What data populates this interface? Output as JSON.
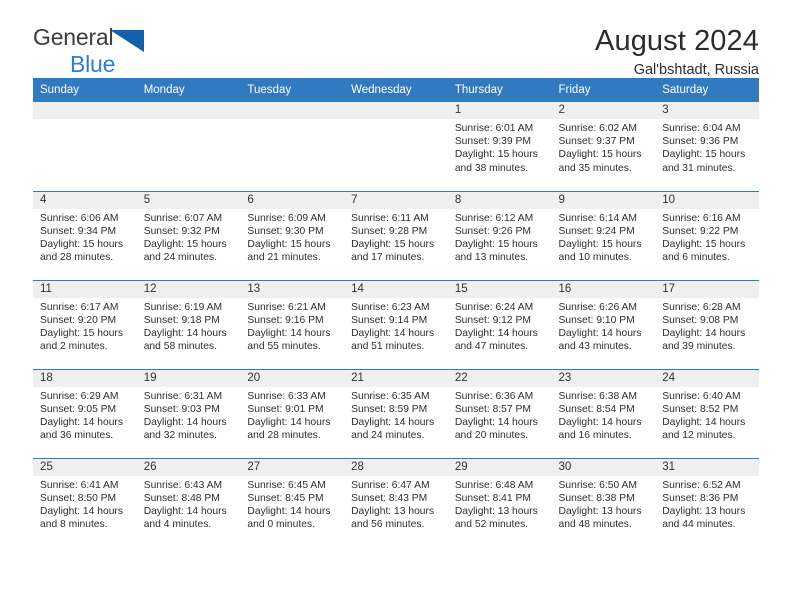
{
  "brand": {
    "name_part1": "General",
    "name_part2": "Blue",
    "logo_icon": "triangle-logo-icon",
    "accent_color": "#2a7fd4"
  },
  "header": {
    "title": "August 2024",
    "location": "Gal'bshtadt, Russia",
    "header_bg": "#3179c0",
    "daynum_bg": "#efefef"
  },
  "weekdays": [
    "Sunday",
    "Monday",
    "Tuesday",
    "Wednesday",
    "Thursday",
    "Friday",
    "Saturday"
  ],
  "labels": {
    "sunrise_prefix": "Sunrise:",
    "sunset_prefix": "Sunset:",
    "daylight_prefix": "Daylight:"
  },
  "weeks": [
    [
      {
        "day": "",
        "sunrise": "",
        "sunset": "",
        "daylight_l1": "",
        "daylight_l2": "",
        "blank": true
      },
      {
        "day": "",
        "sunrise": "",
        "sunset": "",
        "daylight_l1": "",
        "daylight_l2": "",
        "blank": true
      },
      {
        "day": "",
        "sunrise": "",
        "sunset": "",
        "daylight_l1": "",
        "daylight_l2": "",
        "blank": true
      },
      {
        "day": "",
        "sunrise": "",
        "sunset": "",
        "daylight_l1": "",
        "daylight_l2": "",
        "blank": true
      },
      {
        "day": "1",
        "sunrise": "Sunrise: 6:01 AM",
        "sunset": "Sunset: 9:39 PM",
        "daylight_l1": "Daylight: 15 hours",
        "daylight_l2": "and 38 minutes."
      },
      {
        "day": "2",
        "sunrise": "Sunrise: 6:02 AM",
        "sunset": "Sunset: 9:37 PM",
        "daylight_l1": "Daylight: 15 hours",
        "daylight_l2": "and 35 minutes."
      },
      {
        "day": "3",
        "sunrise": "Sunrise: 6:04 AM",
        "sunset": "Sunset: 9:36 PM",
        "daylight_l1": "Daylight: 15 hours",
        "daylight_l2": "and 31 minutes."
      }
    ],
    [
      {
        "day": "4",
        "sunrise": "Sunrise: 6:06 AM",
        "sunset": "Sunset: 9:34 PM",
        "daylight_l1": "Daylight: 15 hours",
        "daylight_l2": "and 28 minutes."
      },
      {
        "day": "5",
        "sunrise": "Sunrise: 6:07 AM",
        "sunset": "Sunset: 9:32 PM",
        "daylight_l1": "Daylight: 15 hours",
        "daylight_l2": "and 24 minutes."
      },
      {
        "day": "6",
        "sunrise": "Sunrise: 6:09 AM",
        "sunset": "Sunset: 9:30 PM",
        "daylight_l1": "Daylight: 15 hours",
        "daylight_l2": "and 21 minutes."
      },
      {
        "day": "7",
        "sunrise": "Sunrise: 6:11 AM",
        "sunset": "Sunset: 9:28 PM",
        "daylight_l1": "Daylight: 15 hours",
        "daylight_l2": "and 17 minutes."
      },
      {
        "day": "8",
        "sunrise": "Sunrise: 6:12 AM",
        "sunset": "Sunset: 9:26 PM",
        "daylight_l1": "Daylight: 15 hours",
        "daylight_l2": "and 13 minutes."
      },
      {
        "day": "9",
        "sunrise": "Sunrise: 6:14 AM",
        "sunset": "Sunset: 9:24 PM",
        "daylight_l1": "Daylight: 15 hours",
        "daylight_l2": "and 10 minutes."
      },
      {
        "day": "10",
        "sunrise": "Sunrise: 6:16 AM",
        "sunset": "Sunset: 9:22 PM",
        "daylight_l1": "Daylight: 15 hours",
        "daylight_l2": "and 6 minutes."
      }
    ],
    [
      {
        "day": "11",
        "sunrise": "Sunrise: 6:17 AM",
        "sunset": "Sunset: 9:20 PM",
        "daylight_l1": "Daylight: 15 hours",
        "daylight_l2": "and 2 minutes."
      },
      {
        "day": "12",
        "sunrise": "Sunrise: 6:19 AM",
        "sunset": "Sunset: 9:18 PM",
        "daylight_l1": "Daylight: 14 hours",
        "daylight_l2": "and 58 minutes."
      },
      {
        "day": "13",
        "sunrise": "Sunrise: 6:21 AM",
        "sunset": "Sunset: 9:16 PM",
        "daylight_l1": "Daylight: 14 hours",
        "daylight_l2": "and 55 minutes."
      },
      {
        "day": "14",
        "sunrise": "Sunrise: 6:23 AM",
        "sunset": "Sunset: 9:14 PM",
        "daylight_l1": "Daylight: 14 hours",
        "daylight_l2": "and 51 minutes."
      },
      {
        "day": "15",
        "sunrise": "Sunrise: 6:24 AM",
        "sunset": "Sunset: 9:12 PM",
        "daylight_l1": "Daylight: 14 hours",
        "daylight_l2": "and 47 minutes."
      },
      {
        "day": "16",
        "sunrise": "Sunrise: 6:26 AM",
        "sunset": "Sunset: 9:10 PM",
        "daylight_l1": "Daylight: 14 hours",
        "daylight_l2": "and 43 minutes."
      },
      {
        "day": "17",
        "sunrise": "Sunrise: 6:28 AM",
        "sunset": "Sunset: 9:08 PM",
        "daylight_l1": "Daylight: 14 hours",
        "daylight_l2": "and 39 minutes."
      }
    ],
    [
      {
        "day": "18",
        "sunrise": "Sunrise: 6:29 AM",
        "sunset": "Sunset: 9:05 PM",
        "daylight_l1": "Daylight: 14 hours",
        "daylight_l2": "and 36 minutes."
      },
      {
        "day": "19",
        "sunrise": "Sunrise: 6:31 AM",
        "sunset": "Sunset: 9:03 PM",
        "daylight_l1": "Daylight: 14 hours",
        "daylight_l2": "and 32 minutes."
      },
      {
        "day": "20",
        "sunrise": "Sunrise: 6:33 AM",
        "sunset": "Sunset: 9:01 PM",
        "daylight_l1": "Daylight: 14 hours",
        "daylight_l2": "and 28 minutes."
      },
      {
        "day": "21",
        "sunrise": "Sunrise: 6:35 AM",
        "sunset": "Sunset: 8:59 PM",
        "daylight_l1": "Daylight: 14 hours",
        "daylight_l2": "and 24 minutes."
      },
      {
        "day": "22",
        "sunrise": "Sunrise: 6:36 AM",
        "sunset": "Sunset: 8:57 PM",
        "daylight_l1": "Daylight: 14 hours",
        "daylight_l2": "and 20 minutes."
      },
      {
        "day": "23",
        "sunrise": "Sunrise: 6:38 AM",
        "sunset": "Sunset: 8:54 PM",
        "daylight_l1": "Daylight: 14 hours",
        "daylight_l2": "and 16 minutes."
      },
      {
        "day": "24",
        "sunrise": "Sunrise: 6:40 AM",
        "sunset": "Sunset: 8:52 PM",
        "daylight_l1": "Daylight: 14 hours",
        "daylight_l2": "and 12 minutes."
      }
    ],
    [
      {
        "day": "25",
        "sunrise": "Sunrise: 6:41 AM",
        "sunset": "Sunset: 8:50 PM",
        "daylight_l1": "Daylight: 14 hours",
        "daylight_l2": "and 8 minutes."
      },
      {
        "day": "26",
        "sunrise": "Sunrise: 6:43 AM",
        "sunset": "Sunset: 8:48 PM",
        "daylight_l1": "Daylight: 14 hours",
        "daylight_l2": "and 4 minutes."
      },
      {
        "day": "27",
        "sunrise": "Sunrise: 6:45 AM",
        "sunset": "Sunset: 8:45 PM",
        "daylight_l1": "Daylight: 14 hours",
        "daylight_l2": "and 0 minutes."
      },
      {
        "day": "28",
        "sunrise": "Sunrise: 6:47 AM",
        "sunset": "Sunset: 8:43 PM",
        "daylight_l1": "Daylight: 13 hours",
        "daylight_l2": "and 56 minutes."
      },
      {
        "day": "29",
        "sunrise": "Sunrise: 6:48 AM",
        "sunset": "Sunset: 8:41 PM",
        "daylight_l1": "Daylight: 13 hours",
        "daylight_l2": "and 52 minutes."
      },
      {
        "day": "30",
        "sunrise": "Sunrise: 6:50 AM",
        "sunset": "Sunset: 8:38 PM",
        "daylight_l1": "Daylight: 13 hours",
        "daylight_l2": "and 48 minutes."
      },
      {
        "day": "31",
        "sunrise": "Sunrise: 6:52 AM",
        "sunset": "Sunset: 8:36 PM",
        "daylight_l1": "Daylight: 13 hours",
        "daylight_l2": "and 44 minutes."
      }
    ]
  ]
}
